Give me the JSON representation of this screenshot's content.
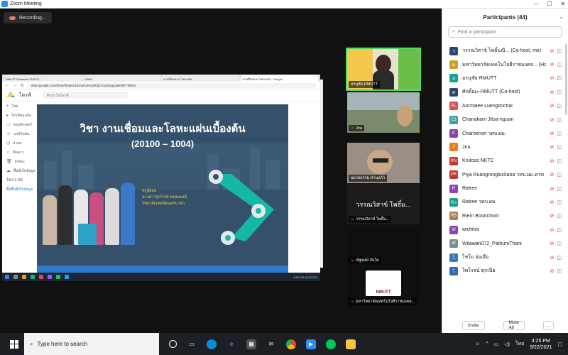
{
  "window": {
    "title": "Zoom Meeting"
  },
  "recording": {
    "label": "Recording..."
  },
  "shared_screen": {
    "tabs": [
      "RMUTT Sukanank เอกสาร...",
      "เกษตร",
      "งานเชื่อมและโลหะแผ่น...",
      "งานเชื่อมและโลหะแผ่น - Google..."
    ],
    "url": "drive.google.com/drive/folders/1Eovmu2H2dR3jCS-pGkagUpk0l8TTbEbN",
    "drive_title": "ไดรฟ์",
    "drive_search": "ค้นหาในไดรฟ์",
    "drive_nav": [
      "ใหม่",
      "ไดรฟ์ของฉัน",
      "คอมพิวเตอร์",
      "แชร์กับฉัน",
      "ล่าสุด",
      "ติดดาว",
      "ถังขยะ",
      "พื้นที่เก็บข้อมูล"
    ],
    "drive_storage": "ใช้ 6.3 GB",
    "drive_buy": "ซื้อพื้นที่เก็บข้อมูล",
    "slide": {
      "title": "วิชา งานเชื่อมและโลหะแผ่นเบื้องต้น",
      "code": "(20100 – 1004)",
      "caption_lines": [
        "ครูผู้สอน",
        "นางสาวรุ่งโรจน์ พรหมพงษ์",
        "วิทยาลัยเทคนิคนครนายก"
      ]
    },
    "taskbar_time": "4:25 PM",
    "taskbar_date": "9/22/2021"
  },
  "video_tiles": [
    {
      "name": "อรนุชัย-RMUTT",
      "active": true,
      "mic_muted": false
    },
    {
      "name": "Jira",
      "active": false,
      "mic_muted": true
    },
    {
      "name": "ผมวลธรรม ท่านแก้ว",
      "active": false,
      "mic_muted": true
    },
    {
      "name": "วรรณวิสาข์ โพธิ์ม...",
      "label_big": "วรรณวิสาข์ โพธิ์ม...",
      "active": false,
      "mic_muted": true
    },
    {
      "name": "ณัฐพงษ์ จันใด",
      "active": false,
      "mic_muted": true
    },
    {
      "name": "มหาวิทยาลัยเทคโนโลยีราชมงคล...",
      "active": false,
      "mic_muted": true,
      "logo_text": "RMUTT"
    }
  ],
  "participants": {
    "title": "Participants (44)",
    "search_placeholder": "Find a participant",
    "list": [
      {
        "name": "วรรณวิสาข์ โพธิ์มณี... (Co-host, me)",
        "initials": "ว",
        "color": "#2b4a6b"
      },
      {
        "name": "มหาวิทยาลัยเทคโนโลยีราชมงคล... (Host)",
        "initials": "ม",
        "color": "#c9a227"
      },
      {
        "name": "อรนุชัย-RMUTT",
        "initials": "อ",
        "color": "#14a38b"
      },
      {
        "name": "ศักดิ์ณะ-RMUTT (Co-host)",
        "initials": "ศ",
        "color": "#2b4a6b"
      },
      {
        "name": "Anchalee Luengsrichai",
        "initials": "AL",
        "color": "#d9534f"
      },
      {
        "name": "Chanakarn Jitsa-nguan",
        "initials": "CJ",
        "color": "#3ca0a0"
      },
      {
        "name": "Charoensri วทบ.ผม.",
        "initials": "C",
        "color": "#8e44ad"
      },
      {
        "name": "Jira",
        "initials": "J",
        "color": "#e67e22"
      },
      {
        "name": "Krutoss NKTC",
        "initials": "KN",
        "color": "#c0392b"
      },
      {
        "name": "Piya Ruangrongluckana วทบ.ผม.ทวท",
        "initials": "PR",
        "color": "#c0392b"
      },
      {
        "name": "Ratree",
        "initials": "R",
        "color": "#8e44ad"
      },
      {
        "name": "Ratree วทบ.ผม.",
        "initials": "Rว",
        "color": "#16a085"
      },
      {
        "name": "Riem Boonchom",
        "initials": "RB",
        "color": "#b07a5a"
      },
      {
        "name": "wichitra",
        "initials": "W",
        "color": "#8e44ad"
      },
      {
        "name": "Wilawan072_PathumThani",
        "initials": "W",
        "color": "#7f8c8d"
      },
      {
        "name": "ไชโย จ่อเสือ",
        "initials": "ไ",
        "color": "#3d7ab3"
      },
      {
        "name": "ไพโรจน์ ดุกเนีย",
        "initials": "ไ",
        "color": "#2d6cb3"
      }
    ],
    "invite_label": "Invite",
    "mute_all_label": "Mute All",
    "more_label": "..."
  },
  "taskbar": {
    "search_placeholder": "Type here to search",
    "time": "4:25 PM",
    "date": "9/22/2021",
    "lang": "ไทย"
  }
}
